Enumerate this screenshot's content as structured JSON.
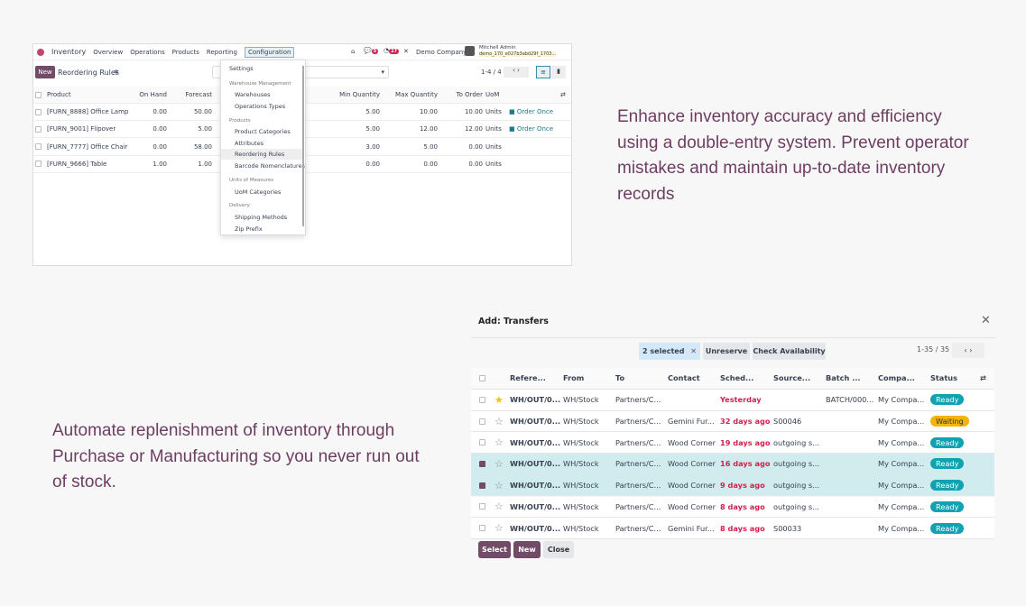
{
  "promo": {
    "top": "Enhance inventory accuracy and efficiency using a double-entry system. Prevent operator mistakes and maintain up-to-date inventory records",
    "bottom": "Automate replenishment of inventory through Purchase or Manufacturing so you never run out of stock."
  },
  "app": {
    "nav": [
      "Inventory",
      "Overview",
      "Operations",
      "Products",
      "Reporting",
      "Configuration"
    ],
    "company": "Demo Company",
    "user": "Mitchell Admin",
    "db": "demo_170_e027b3abd29f_1703...",
    "msg_count": "5",
    "activity_count": "27",
    "new_label": "New",
    "title": "Reordering Rules",
    "pager": "1-4 / 4",
    "columns": [
      "Product",
      "On Hand",
      "Forecast",
      "Min Quantity",
      "Max Quantity",
      "To Order",
      "UoM"
    ],
    "rows": [
      {
        "product": "[FURN_8888] Office Lamp",
        "on_hand": "0.00",
        "forecast": "50.00",
        "min": "5.00",
        "max": "10.00",
        "to_order": "10.00",
        "uom": "Units",
        "action": "Order Once"
      },
      {
        "product": "[FURN_9001] Flipover",
        "on_hand": "0.00",
        "forecast": "5.00",
        "min": "5.00",
        "max": "12.00",
        "to_order": "12.00",
        "uom": "Units",
        "action": "Order Once"
      },
      {
        "product": "[FURN_7777] Office Chair",
        "on_hand": "0.00",
        "forecast": "58.00",
        "min": "3.00",
        "max": "5.00",
        "to_order": "0.00",
        "uom": "Units",
        "action": ""
      },
      {
        "product": "[FURN_9666] Table",
        "on_hand": "1.00",
        "forecast": "1.00",
        "min": "0.00",
        "max": "0.00",
        "to_order": "0.00",
        "uom": "Units",
        "action": ""
      }
    ],
    "menu": {
      "settings": "Settings",
      "sec1": "Warehouse Management",
      "warehouses": "Warehouses",
      "optypes": "Operations Types",
      "sec2": "Products",
      "prodcat": "Product Categories",
      "attributes": "Attributes",
      "reorder": "Reordering Rules",
      "barcode": "Barcode Nomenclatures",
      "sec3": "Units of Measures",
      "uomcat": "UoM Categories",
      "sec4": "Delivery",
      "shipping": "Shipping Methods",
      "zip": "Zip Prefix"
    }
  },
  "dialog": {
    "title": "Add: Transfers",
    "selected": "2 selected",
    "unreserve": "Unreserve",
    "check": "Check Availability",
    "pager": "1-35 / 35",
    "columns": [
      "Refere...",
      "From",
      "To",
      "Contact",
      "Sched...",
      "Source...",
      "Batch ...",
      "Compa...",
      "Status"
    ],
    "rows": [
      {
        "star": true,
        "checked": false,
        "ref": "WH/OUT/0...",
        "from": "WH/Stock",
        "to": "Partners/C...",
        "contact": "",
        "sched": "Yesterday",
        "source": "",
        "batch": "BATCH/000...",
        "company": "My Compa...",
        "status": "Ready"
      },
      {
        "star": false,
        "checked": false,
        "ref": "WH/OUT/0...",
        "from": "WH/Stock",
        "to": "Partners/C...",
        "contact": "Gemini Fur...",
        "sched": "32 days ago",
        "source": "S00046",
        "batch": "",
        "company": "My Compa...",
        "status": "Waiting"
      },
      {
        "star": false,
        "checked": false,
        "ref": "WH/OUT/0...",
        "from": "WH/Stock",
        "to": "Partners/C...",
        "contact": "Wood Corner",
        "sched": "19 days ago",
        "source": "outgoing s...",
        "batch": "",
        "company": "My Compa...",
        "status": "Ready"
      },
      {
        "star": false,
        "checked": true,
        "ref": "WH/OUT/0...",
        "from": "WH/Stock",
        "to": "Partners/C...",
        "contact": "Wood Corner",
        "sched": "16 days ago",
        "source": "outgoing s...",
        "batch": "",
        "company": "My Compa...",
        "status": "Ready"
      },
      {
        "star": false,
        "checked": true,
        "ref": "WH/OUT/0...",
        "from": "WH/Stock",
        "to": "Partners/C...",
        "contact": "Wood Corner",
        "sched": "9 days ago",
        "source": "outgoing s...",
        "batch": "",
        "company": "My Compa...",
        "status": "Ready"
      },
      {
        "star": false,
        "checked": false,
        "ref": "WH/OUT/0...",
        "from": "WH/Stock",
        "to": "Partners/C...",
        "contact": "Wood Corner",
        "sched": "8 days ago",
        "source": "outgoing s...",
        "batch": "",
        "company": "My Compa...",
        "status": "Ready"
      },
      {
        "star": false,
        "checked": false,
        "ref": "WH/OUT/0...",
        "from": "WH/Stock",
        "to": "Partners/C...",
        "contact": "Gemini Fur...",
        "sched": "8 days ago",
        "source": "S00033",
        "batch": "",
        "company": "My Compa...",
        "status": "Ready"
      }
    ],
    "select": "Select",
    "new": "New",
    "close": "Close"
  },
  "colors": {
    "brand": "#714b67",
    "promo": "#6e3d62",
    "ready": "#0fa2b3",
    "waiting": "#f5b40c",
    "selected_row": "#d1ecee"
  }
}
